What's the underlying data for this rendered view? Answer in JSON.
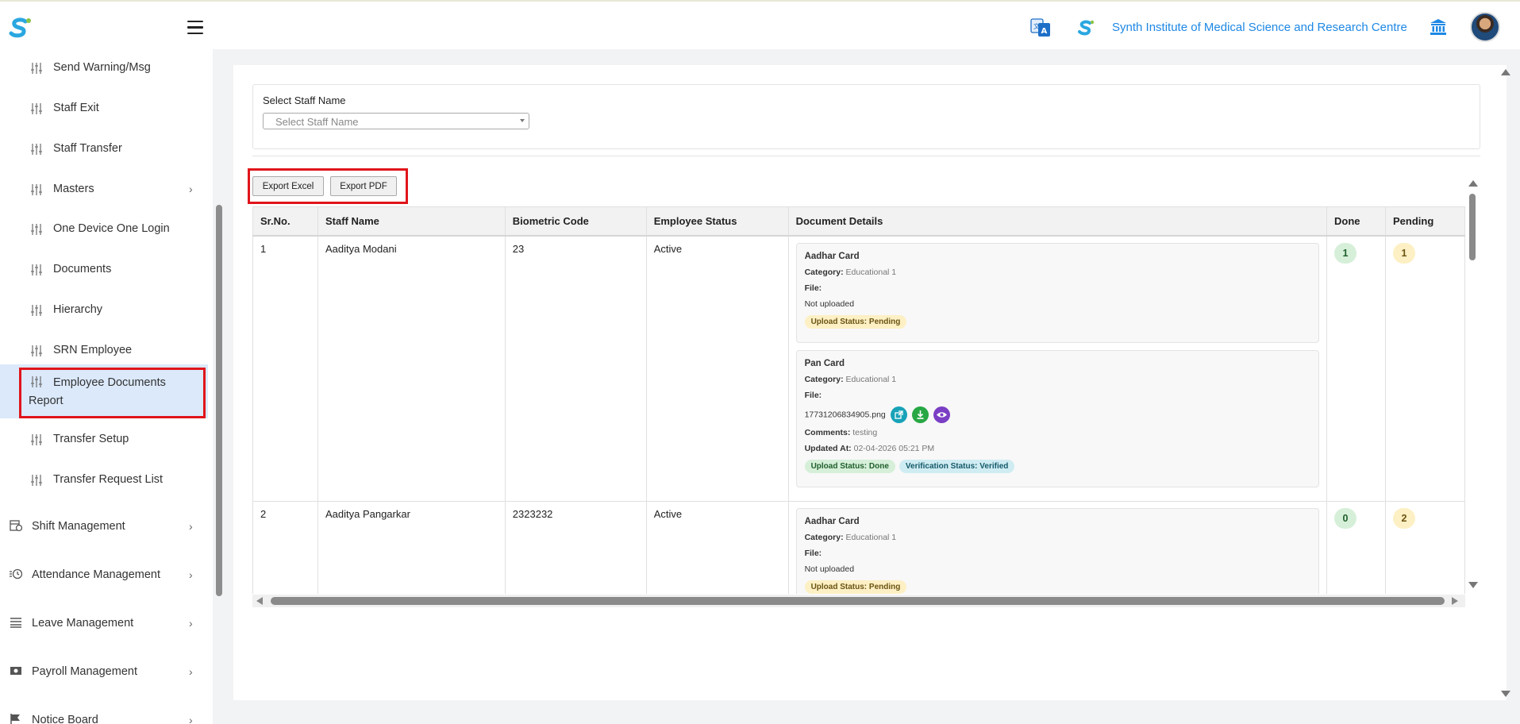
{
  "header": {
    "institution_name": "Synth Institute of Medical Science and Research Centre",
    "brand_color": "#1e88e5"
  },
  "sidebar": {
    "items": [
      {
        "label": "Send Warning/Msg",
        "icon": "sliders-icon"
      },
      {
        "label": "Staff Exit",
        "icon": "sliders-icon"
      },
      {
        "label": "Staff Transfer",
        "icon": "sliders-icon"
      },
      {
        "label": "Masters",
        "icon": "sliders-icon",
        "has_submenu": true
      },
      {
        "label": "One Device One Login",
        "icon": "sliders-icon"
      },
      {
        "label": "Documents",
        "icon": "sliders-icon"
      },
      {
        "label": "Hierarchy",
        "icon": "sliders-icon"
      },
      {
        "label": "SRN Employee",
        "icon": "sliders-icon"
      },
      {
        "label_line1": "Employee Documents",
        "label_line2": "Report",
        "icon": "sliders-icon",
        "active": true
      },
      {
        "label": "Transfer Setup",
        "icon": "sliders-icon"
      },
      {
        "label": "Transfer Request List",
        "icon": "sliders-icon"
      }
    ],
    "modules": [
      {
        "label": "Shift Management",
        "icon": "shift-icon"
      },
      {
        "label": "Attendance Management",
        "icon": "clock-icon"
      },
      {
        "label": "Leave Management",
        "icon": "list-icon"
      },
      {
        "label": "Payroll Management",
        "icon": "money-icon"
      },
      {
        "label": "Notice Board",
        "icon": "flag-icon"
      }
    ]
  },
  "filter": {
    "label": "Select Staff Name",
    "placeholder": "Select Staff Name"
  },
  "toolbar": {
    "export_excel": "Export Excel",
    "export_pdf": "Export PDF"
  },
  "table": {
    "headers": [
      "Sr.No.",
      "Staff Name",
      "Biometric Code",
      "Employee Status",
      "Document Details",
      "Done",
      "Pending"
    ],
    "rows": [
      {
        "sr": "1",
        "name": "Aaditya Modani",
        "code": "23",
        "status": "Active",
        "done": "1",
        "pending": "1",
        "docs": [
          {
            "title": "Aadhar Card",
            "category_label": "Category:",
            "category": "Educational 1",
            "file_label": "File:",
            "file_value": "Not uploaded",
            "upload_status": "Upload Status: Pending"
          },
          {
            "title": "Pan Card",
            "category_label": "Category:",
            "category": "Educational 1",
            "file_label": "File:",
            "file_name": "17731206834905.png",
            "comments_label": "Comments:",
            "comments": "testing",
            "updated_label": "Updated At:",
            "updated": "02-04-2026 05:21 PM",
            "upload_status": "Upload Status: Done",
            "verification_status": "Verification Status: Verified"
          }
        ]
      },
      {
        "sr": "2",
        "name": "Aaditya Pangarkar",
        "code": "2323232",
        "status": "Active",
        "done": "0",
        "pending": "2",
        "docs": [
          {
            "title": "Aadhar Card",
            "category_label": "Category:",
            "category": "Educational 1",
            "file_label": "File:",
            "file_value": "Not uploaded",
            "upload_status": "Upload Status: Pending"
          }
        ]
      }
    ]
  }
}
